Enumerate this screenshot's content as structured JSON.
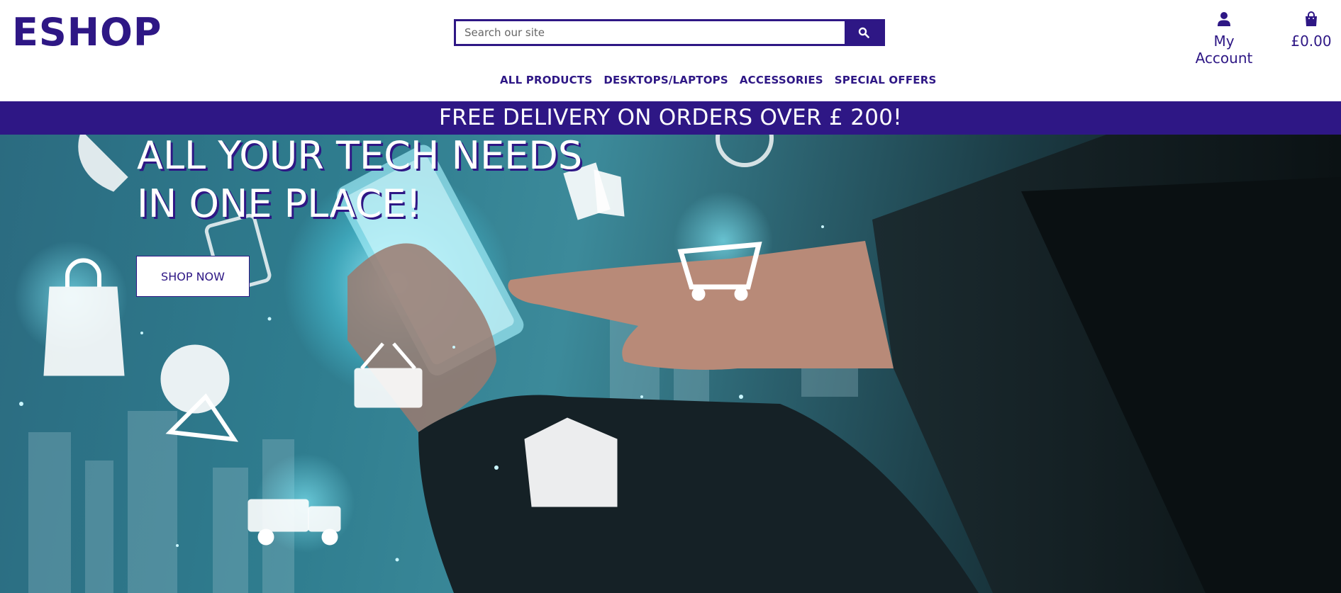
{
  "brand": {
    "logo_text": "ESHOP",
    "accent_color": "#2e1785"
  },
  "search": {
    "placeholder": "Search our site",
    "button_icon": "search-icon"
  },
  "account": {
    "icon": "user-icon",
    "label": "My Account"
  },
  "cart": {
    "icon": "shopping-bag-icon",
    "total": "£0.00"
  },
  "nav": {
    "items": [
      {
        "label": "ALL PRODUCTS"
      },
      {
        "label": "DESKTOPS/LAPTOPS"
      },
      {
        "label": "ACCESSORIES"
      },
      {
        "label": "SPECIAL OFFERS"
      }
    ]
  },
  "banner": {
    "text": "FREE DELIVERY ON ORDERS OVER £ 200!"
  },
  "hero": {
    "title_line1": "ALL YOUR TECH NEEDS",
    "title_line2": "IN ONE PLACE!",
    "cta_label": "SHOP NOW",
    "image_description_icons": [
      "phone-icon",
      "sale-tag-icon",
      "shopping-bag-icon",
      "cart-icon",
      "basket-icon",
      "store-icon",
      "delivery-truck-icon",
      "chat-cart-icon"
    ]
  }
}
